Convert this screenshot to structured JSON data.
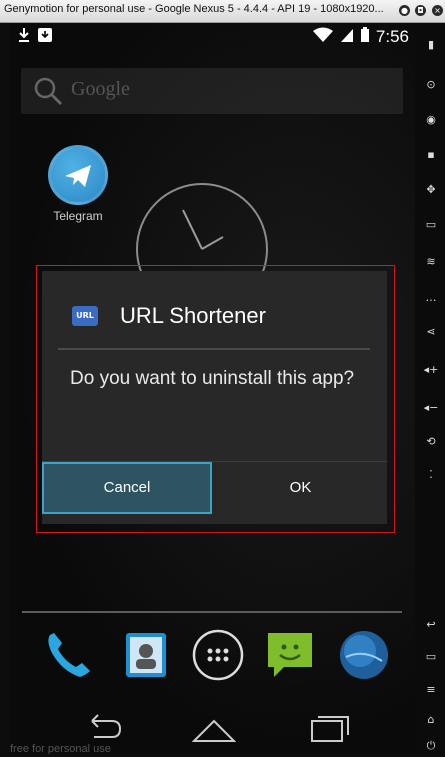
{
  "window": {
    "title": "Genymotion for personal use - Google Nexus 5 - 4.4.4 - API 19 - 1080x1920..."
  },
  "statusbar": {
    "time": "7:56"
  },
  "search": {
    "placeholder": "Google"
  },
  "home": {
    "apps": [
      {
        "label": "Telegram"
      }
    ]
  },
  "dialog": {
    "title": "URL Shortener",
    "app_icon_text": "URL",
    "message": "Do you want to uninstall this app?",
    "cancel_label": "Cancel",
    "ok_label": "OK"
  },
  "watermark": "free for personal use",
  "colors": {
    "dialog_bg": "#282828",
    "cancel_highlight": "#3aa3c6",
    "outline": "#d11a1a"
  }
}
